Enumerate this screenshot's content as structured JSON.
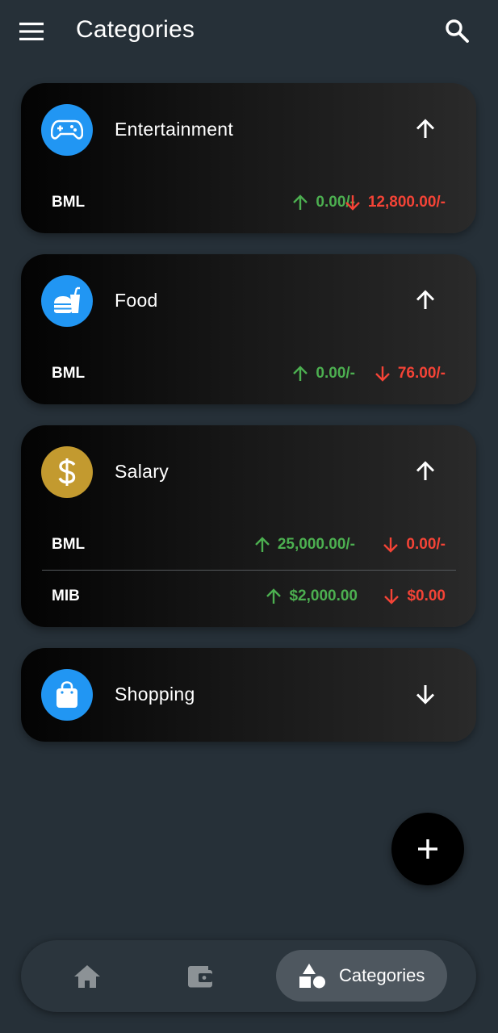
{
  "header": {
    "title": "Categories"
  },
  "categories": [
    {
      "name": "Entertainment",
      "icon": "gamepad-icon",
      "icon_color": "#2196f3",
      "expanded": true,
      "toggle": "arrow-up-icon",
      "accounts": [
        {
          "name": "BML",
          "income": "0.00/-",
          "expense": "12,800.00/-"
        }
      ]
    },
    {
      "name": "Food",
      "icon": "fastfood-icon",
      "icon_color": "#2196f3",
      "expanded": true,
      "toggle": "arrow-up-icon",
      "accounts": [
        {
          "name": "BML",
          "income": "0.00/-",
          "expense": "76.00/-"
        }
      ]
    },
    {
      "name": "Salary",
      "icon": "dollar-icon",
      "icon_color": "#c39a2f",
      "expanded": true,
      "toggle": "arrow-up-icon",
      "accounts": [
        {
          "name": "BML",
          "income": "25,000.00/-",
          "expense": "0.00/-"
        },
        {
          "name": "MIB",
          "income": "$2,000.00",
          "expense": "$0.00"
        }
      ]
    },
    {
      "name": "Shopping",
      "icon": "shopping-bag-icon",
      "icon_color": "#2196f3",
      "expanded": false,
      "toggle": "arrow-down-icon",
      "accounts": []
    }
  ],
  "colors": {
    "income": "#4caf50",
    "expense": "#f44336",
    "background": "#263038"
  },
  "bottom_nav": {
    "items": [
      {
        "icon": "home-icon",
        "label": ""
      },
      {
        "icon": "wallet-icon",
        "label": ""
      },
      {
        "icon": "categories-icon",
        "label": "Categories",
        "active": true
      }
    ]
  },
  "fab": {
    "icon": "plus-icon"
  }
}
